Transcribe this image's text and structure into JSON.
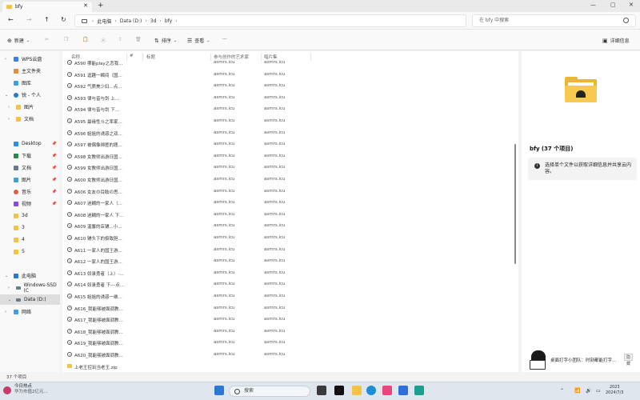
{
  "window": {
    "tab_title": "bfy",
    "new_tab": "+",
    "controls": {
      "minimize": "—",
      "maximize": "▢",
      "close": "✕"
    }
  },
  "address": {
    "crumbs": [
      "此电脑",
      "Data (D:)",
      "3d",
      "bfy"
    ],
    "search_placeholder": "在 bfy 中搜索"
  },
  "toolbar": {
    "new_label": "新建",
    "sort_label": "排序",
    "view_label": "查看",
    "more_label": "···",
    "details_label": "详细信息"
  },
  "sidebar": {
    "items": [
      {
        "label": "WPS云盘",
        "color": "#3d7bf5"
      },
      {
        "label": "主文件夹",
        "color": "#e88b3a"
      },
      {
        "label": "图库",
        "color": "#3ba0e6"
      },
      {
        "label": "锐 - 个人",
        "color": "#2b78d4"
      },
      {
        "label": "图片",
        "color": "#f5c344"
      },
      {
        "label": "文档",
        "color": "#f5c344"
      },
      {
        "label": "Desktop",
        "color": "#2b8fe0"
      },
      {
        "label": "下载",
        "color": "#2a8a4a"
      },
      {
        "label": "文档",
        "color": "#6b7b8c"
      },
      {
        "label": "图片",
        "color": "#3ba0e6"
      },
      {
        "label": "音乐",
        "color": "#e25b4a"
      },
      {
        "label": "视频",
        "color": "#8a4ae2"
      },
      {
        "label": "3d",
        "color": "#f5c344"
      },
      {
        "label": "3",
        "color": "#f5c344"
      },
      {
        "label": "4",
        "color": "#f5c344"
      },
      {
        "label": "5",
        "color": "#f5c344"
      },
      {
        "label": "此电脑",
        "color": "#2b78d4"
      },
      {
        "label": "Windows-SSD (C",
        "color": "#6b7b8c"
      },
      {
        "label": "Data (D:)",
        "color": "#6b7b8c"
      },
      {
        "label": "网络",
        "color": "#3ba0e6"
      }
    ]
  },
  "columns": {
    "name": "名称",
    "num": "#",
    "title": "标题",
    "artist": "参与创作的艺术家",
    "album": "唱片集"
  },
  "files": [
    {
      "name": "A590 哪能play之恋我...",
      "artist": "asmrs.icu",
      "album": "asmrs.icu"
    },
    {
      "name": "A591 逗趣一瞬间（国...",
      "artist": "asmrs.icu",
      "album": "asmrs.icu"
    },
    {
      "name": "A592 气质美少妇...点...",
      "artist": "asmrs.icu",
      "album": "asmrs.icu"
    },
    {
      "name": "A593 律与音与剑 上...",
      "artist": "asmrs.icu",
      "album": "asmrs.icu"
    },
    {
      "name": "A594 律与音与剑 下...",
      "artist": "asmrs.icu",
      "album": "asmrs.icu"
    },
    {
      "name": "A595 最缘性斗之率家...",
      "artist": "asmrs.icu",
      "album": "asmrs.icu"
    },
    {
      "name": "A596 姐姐的诱惑之双...",
      "artist": "asmrs.icu",
      "album": "asmrs.icu"
    },
    {
      "name": "A597 被偶像绑匿的题...",
      "artist": "asmrs.icu",
      "album": "asmrs.icu"
    },
    {
      "name": "A598 女教师出游日国...",
      "artist": "asmrs.icu",
      "album": "asmrs.icu"
    },
    {
      "name": "A599 女教师出游日国...",
      "artist": "asmrs.icu",
      "album": "asmrs.icu"
    },
    {
      "name": "A600 女教师出游日国...",
      "artist": "asmrs.icu",
      "album": "asmrs.icu"
    },
    {
      "name": "A606 女友の目眩の思...",
      "artist": "asmrs.icu",
      "album": "asmrs.icu"
    },
    {
      "name": "A607 迷糊的一家人（...",
      "artist": "asmrs.icu",
      "album": "asmrs.icu"
    },
    {
      "name": "A608 迷糊的一家人 下...",
      "artist": "asmrs.icu",
      "album": "asmrs.icu"
    },
    {
      "name": "A609 温馨的店铺...小...",
      "artist": "asmrs.icu",
      "album": "asmrs.icu"
    },
    {
      "name": "A610 辅头下的极致胆...",
      "artist": "asmrs.icu",
      "album": "asmrs.icu"
    },
    {
      "name": "A611 一家人的国王游...",
      "artist": "asmrs.icu",
      "album": "asmrs.icu"
    },
    {
      "name": "A612 一家人的国王游...",
      "artist": "asmrs.icu",
      "album": "asmrs.icu"
    },
    {
      "name": "A613 奴录勇者（上）-...",
      "artist": "asmrs.icu",
      "album": "asmrs.icu"
    },
    {
      "name": "A614 奴录勇者 下---点...",
      "artist": "asmrs.icu",
      "album": "asmrs.icu"
    },
    {
      "name": "A615 姐姐的诱惑一维...",
      "artist": "asmrs.icu",
      "album": "asmrs.icu"
    },
    {
      "name": "A616_我能够被面调教...",
      "artist": "asmrs.icu",
      "album": "asmrs.icu"
    },
    {
      "name": "A617_我能够被面调教...",
      "artist": "asmrs.icu",
      "album": "asmrs.icu"
    },
    {
      "name": "A618_我能够被面调教...",
      "artist": "asmrs.icu",
      "album": "asmrs.icu"
    },
    {
      "name": "A619_我能够被面调教...",
      "artist": "asmrs.icu",
      "album": "asmrs.icu"
    },
    {
      "name": "A620_我能够被面调教...",
      "artist": "asmrs.icu",
      "album": "asmrs.icu"
    },
    {
      "name": "上老王控玩当老王.zip",
      "artist": "",
      "album": ""
    }
  ],
  "details": {
    "folder_name": "bfy",
    "folder_count": "(37 个项目)",
    "hint": "选择单个文件以获取详细信息并共享云内容。"
  },
  "status": {
    "count": "37 个项目"
  },
  "taskbar": {
    "weather_title": "今日热点",
    "weather_sub": "华为市值2亿元...",
    "search_label": "搜索",
    "time": "2023",
    "date": "2024/7/3",
    "popup_text": "桌面打字小团队：时刻都能打字...",
    "popup_close": "隐藏"
  }
}
